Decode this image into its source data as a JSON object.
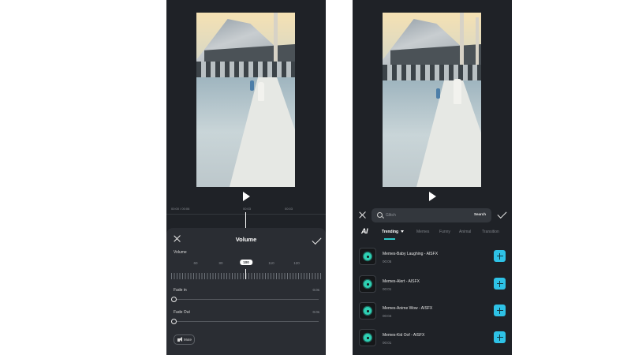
{
  "colors": {
    "panel_background": "#1f2227",
    "sheet_background": "#2a2d33",
    "accent_teal": "#2ec7c7",
    "add_button": "#2ec2e6"
  },
  "left_screen": {
    "timeline": {
      "current_time": "00:00",
      "total_time": "00:06",
      "marker_1": "00:03",
      "marker_2": "00:03"
    },
    "volume_panel": {
      "title": "Volume",
      "close_icon": "close-icon",
      "confirm_icon": "check-icon",
      "volume_label": "Volume",
      "scale": {
        "labels": [
          "60",
          "80",
          "100",
          "110",
          "120"
        ],
        "selected": "100"
      },
      "fade_in": {
        "label": "Fade in",
        "value": "0.0s",
        "level": 0
      },
      "fade_out": {
        "label": "Fade Out",
        "value": "0.0s",
        "level": 0
      },
      "mute_button": {
        "label": "Mute",
        "icon": "speaker-icon"
      }
    }
  },
  "right_screen": {
    "search": {
      "placeholder": "Glitch",
      "submit_label": "Search",
      "icon": "search-icon"
    },
    "tabs": {
      "logo": "AI",
      "items": [
        {
          "label": "Trending",
          "active": true
        },
        {
          "label": "Memes",
          "active": false
        },
        {
          "label": "Funny",
          "active": false
        },
        {
          "label": "Animal",
          "active": false
        },
        {
          "label": "Transition",
          "active": false
        }
      ]
    },
    "sound_effects": [
      {
        "name": "Memes-Baby Laughing - AISFX",
        "duration": "00:05"
      },
      {
        "name": "Memes-Alert - AISFX",
        "duration": "00:01"
      },
      {
        "name": "Memes-Anime Wow - AISFX",
        "duration": "00:04"
      },
      {
        "name": "Memes-Kid Oof - AISFX",
        "duration": "00:01"
      }
    ]
  }
}
